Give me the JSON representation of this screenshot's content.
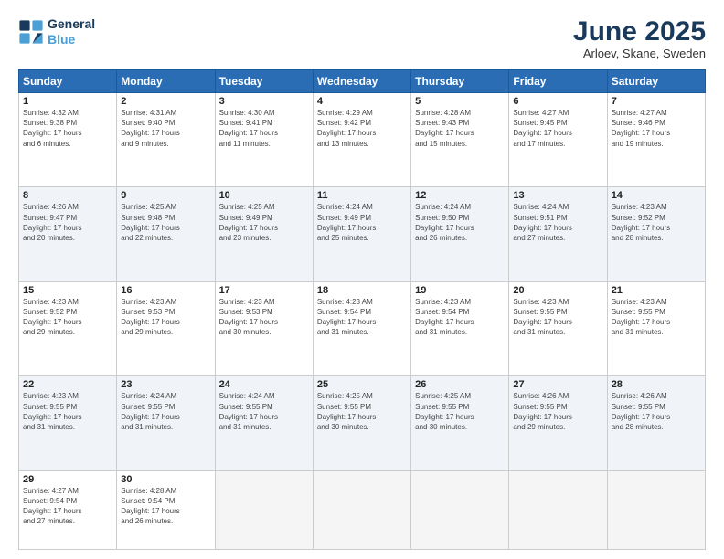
{
  "logo": {
    "line1": "General",
    "line2": "Blue"
  },
  "title": "June 2025",
  "subtitle": "Arloev, Skane, Sweden",
  "days_header": [
    "Sunday",
    "Monday",
    "Tuesday",
    "Wednesday",
    "Thursday",
    "Friday",
    "Saturday"
  ],
  "weeks": [
    [
      {
        "num": "1",
        "info": "Sunrise: 4:32 AM\nSunset: 9:38 PM\nDaylight: 17 hours\nand 6 minutes."
      },
      {
        "num": "2",
        "info": "Sunrise: 4:31 AM\nSunset: 9:40 PM\nDaylight: 17 hours\nand 9 minutes."
      },
      {
        "num": "3",
        "info": "Sunrise: 4:30 AM\nSunset: 9:41 PM\nDaylight: 17 hours\nand 11 minutes."
      },
      {
        "num": "4",
        "info": "Sunrise: 4:29 AM\nSunset: 9:42 PM\nDaylight: 17 hours\nand 13 minutes."
      },
      {
        "num": "5",
        "info": "Sunrise: 4:28 AM\nSunset: 9:43 PM\nDaylight: 17 hours\nand 15 minutes."
      },
      {
        "num": "6",
        "info": "Sunrise: 4:27 AM\nSunset: 9:45 PM\nDaylight: 17 hours\nand 17 minutes."
      },
      {
        "num": "7",
        "info": "Sunrise: 4:27 AM\nSunset: 9:46 PM\nDaylight: 17 hours\nand 19 minutes."
      }
    ],
    [
      {
        "num": "8",
        "info": "Sunrise: 4:26 AM\nSunset: 9:47 PM\nDaylight: 17 hours\nand 20 minutes."
      },
      {
        "num": "9",
        "info": "Sunrise: 4:25 AM\nSunset: 9:48 PM\nDaylight: 17 hours\nand 22 minutes."
      },
      {
        "num": "10",
        "info": "Sunrise: 4:25 AM\nSunset: 9:49 PM\nDaylight: 17 hours\nand 23 minutes."
      },
      {
        "num": "11",
        "info": "Sunrise: 4:24 AM\nSunset: 9:49 PM\nDaylight: 17 hours\nand 25 minutes."
      },
      {
        "num": "12",
        "info": "Sunrise: 4:24 AM\nSunset: 9:50 PM\nDaylight: 17 hours\nand 26 minutes."
      },
      {
        "num": "13",
        "info": "Sunrise: 4:24 AM\nSunset: 9:51 PM\nDaylight: 17 hours\nand 27 minutes."
      },
      {
        "num": "14",
        "info": "Sunrise: 4:23 AM\nSunset: 9:52 PM\nDaylight: 17 hours\nand 28 minutes."
      }
    ],
    [
      {
        "num": "15",
        "info": "Sunrise: 4:23 AM\nSunset: 9:52 PM\nDaylight: 17 hours\nand 29 minutes."
      },
      {
        "num": "16",
        "info": "Sunrise: 4:23 AM\nSunset: 9:53 PM\nDaylight: 17 hours\nand 29 minutes."
      },
      {
        "num": "17",
        "info": "Sunrise: 4:23 AM\nSunset: 9:53 PM\nDaylight: 17 hours\nand 30 minutes."
      },
      {
        "num": "18",
        "info": "Sunrise: 4:23 AM\nSunset: 9:54 PM\nDaylight: 17 hours\nand 31 minutes."
      },
      {
        "num": "19",
        "info": "Sunrise: 4:23 AM\nSunset: 9:54 PM\nDaylight: 17 hours\nand 31 minutes."
      },
      {
        "num": "20",
        "info": "Sunrise: 4:23 AM\nSunset: 9:55 PM\nDaylight: 17 hours\nand 31 minutes."
      },
      {
        "num": "21",
        "info": "Sunrise: 4:23 AM\nSunset: 9:55 PM\nDaylight: 17 hours\nand 31 minutes."
      }
    ],
    [
      {
        "num": "22",
        "info": "Sunrise: 4:23 AM\nSunset: 9:55 PM\nDaylight: 17 hours\nand 31 minutes."
      },
      {
        "num": "23",
        "info": "Sunrise: 4:24 AM\nSunset: 9:55 PM\nDaylight: 17 hours\nand 31 minutes."
      },
      {
        "num": "24",
        "info": "Sunrise: 4:24 AM\nSunset: 9:55 PM\nDaylight: 17 hours\nand 31 minutes."
      },
      {
        "num": "25",
        "info": "Sunrise: 4:25 AM\nSunset: 9:55 PM\nDaylight: 17 hours\nand 30 minutes."
      },
      {
        "num": "26",
        "info": "Sunrise: 4:25 AM\nSunset: 9:55 PM\nDaylight: 17 hours\nand 30 minutes."
      },
      {
        "num": "27",
        "info": "Sunrise: 4:26 AM\nSunset: 9:55 PM\nDaylight: 17 hours\nand 29 minutes."
      },
      {
        "num": "28",
        "info": "Sunrise: 4:26 AM\nSunset: 9:55 PM\nDaylight: 17 hours\nand 28 minutes."
      }
    ],
    [
      {
        "num": "29",
        "info": "Sunrise: 4:27 AM\nSunset: 9:54 PM\nDaylight: 17 hours\nand 27 minutes."
      },
      {
        "num": "30",
        "info": "Sunrise: 4:28 AM\nSunset: 9:54 PM\nDaylight: 17 hours\nand 26 minutes."
      },
      {
        "num": "",
        "info": ""
      },
      {
        "num": "",
        "info": ""
      },
      {
        "num": "",
        "info": ""
      },
      {
        "num": "",
        "info": ""
      },
      {
        "num": "",
        "info": ""
      }
    ]
  ]
}
